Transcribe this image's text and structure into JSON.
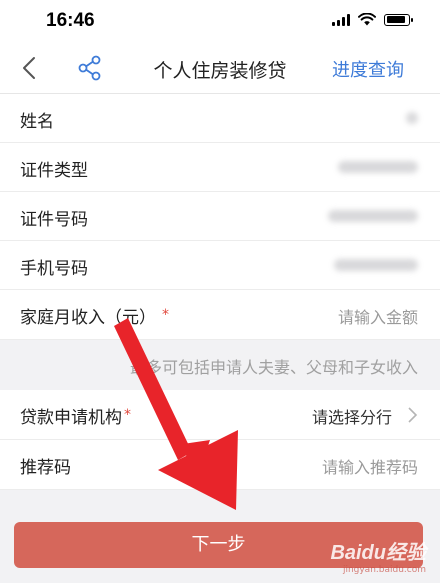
{
  "status_bar": {
    "time": "16:46"
  },
  "nav": {
    "title": "个人住房装修贷",
    "action": "进度查询"
  },
  "form": {
    "rows": [
      {
        "label": "姓名"
      },
      {
        "label": "证件类型"
      },
      {
        "label": "证件号码"
      },
      {
        "label": "手机号码"
      }
    ],
    "income": {
      "label": "家庭月收入（元）",
      "required_mark": "*",
      "placeholder": "请输入金额"
    },
    "income_hint": "最多可包括申请人夫妻、父母和子女收入",
    "branch": {
      "label": "贷款申请机构",
      "required_mark": "*",
      "value": "请选择分行"
    },
    "referral": {
      "label": "推荐码",
      "placeholder": "请输入推荐码"
    }
  },
  "next_button": {
    "label": "下一步"
  },
  "watermark": {
    "logo": "Baidu经验",
    "sub": "jingyan.baidu.com"
  },
  "colors": {
    "accent": "#3e7bd8",
    "button": "#d6675b",
    "required": "#e0483d",
    "arrow": "#e8242a"
  },
  "icons": [
    "back-icon",
    "share-icon",
    "chevron-right-icon",
    "signal-icon",
    "wifi-icon",
    "battery-icon"
  ]
}
